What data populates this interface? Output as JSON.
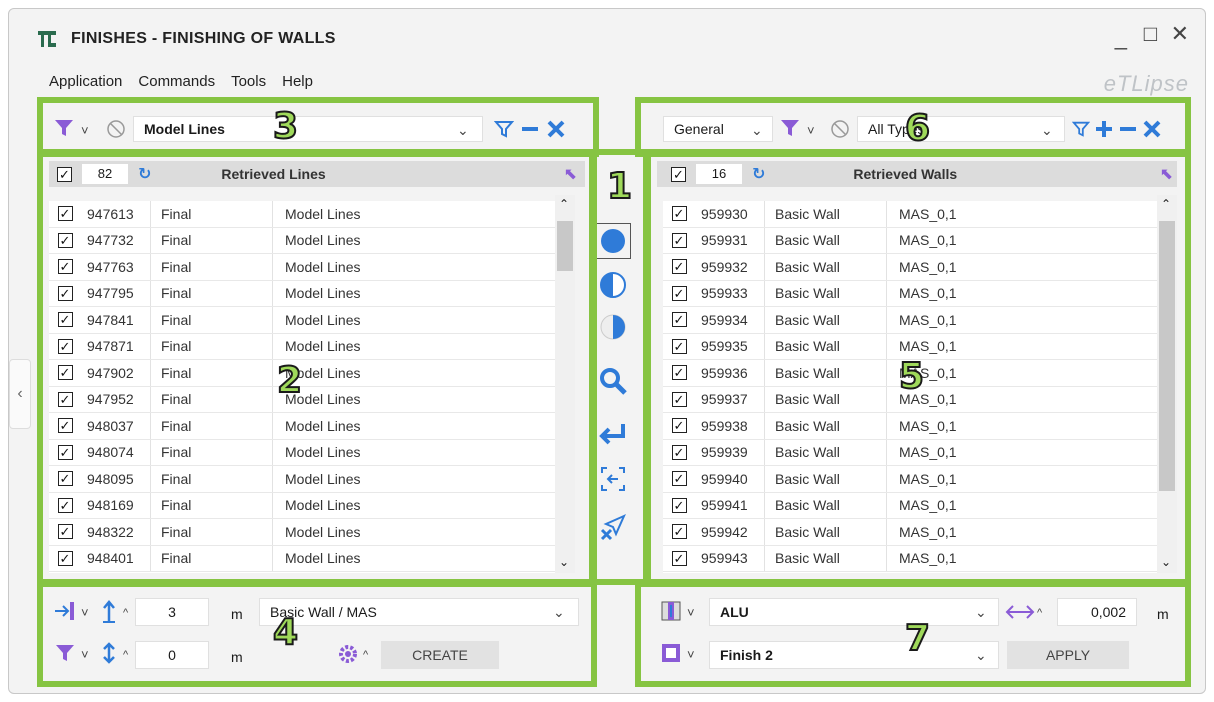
{
  "window": {
    "title": "FINISHES - FINISHING OF WALLS",
    "brand": "eTLipse"
  },
  "menu": [
    "Application",
    "Commands",
    "Tools",
    "Help"
  ],
  "left_filter": {
    "selected": "Model Lines"
  },
  "right_filter": {
    "category": "General",
    "selected": "All Types"
  },
  "left_list": {
    "count": "82",
    "header": "Retrieved Lines",
    "rows": [
      [
        "947613",
        "Final",
        "Model Lines"
      ],
      [
        "947732",
        "Final",
        "Model Lines"
      ],
      [
        "947763",
        "Final",
        "Model Lines"
      ],
      [
        "947795",
        "Final",
        "Model Lines"
      ],
      [
        "947841",
        "Final",
        "Model Lines"
      ],
      [
        "947871",
        "Final",
        "Model Lines"
      ],
      [
        "947902",
        "Final",
        "Model Lines"
      ],
      [
        "947952",
        "Final",
        "Model Lines"
      ],
      [
        "948037",
        "Final",
        "Model Lines"
      ],
      [
        "948074",
        "Final",
        "Model Lines"
      ],
      [
        "948095",
        "Final",
        "Model Lines"
      ],
      [
        "948169",
        "Final",
        "Model Lines"
      ],
      [
        "948322",
        "Final",
        "Model Lines"
      ],
      [
        "948401",
        "Final",
        "Model Lines"
      ]
    ]
  },
  "right_list": {
    "count": "16",
    "header": "Retrieved Walls",
    "rows": [
      [
        "959930",
        "Basic Wall",
        "MAS_0,1"
      ],
      [
        "959931",
        "Basic Wall",
        "MAS_0,1"
      ],
      [
        "959932",
        "Basic Wall",
        "MAS_0,1"
      ],
      [
        "959933",
        "Basic Wall",
        "MAS_0,1"
      ],
      [
        "959934",
        "Basic Wall",
        "MAS_0,1"
      ],
      [
        "959935",
        "Basic Wall",
        "MAS_0,1"
      ],
      [
        "959936",
        "Basic Wall",
        "MAS_0,1"
      ],
      [
        "959937",
        "Basic Wall",
        "MAS_0,1"
      ],
      [
        "959938",
        "Basic Wall",
        "MAS_0,1"
      ],
      [
        "959939",
        "Basic Wall",
        "MAS_0,1"
      ],
      [
        "959940",
        "Basic Wall",
        "MAS_0,1"
      ],
      [
        "959941",
        "Basic Wall",
        "MAS_0,1"
      ],
      [
        "959942",
        "Basic Wall",
        "MAS_0,1"
      ],
      [
        "959943",
        "Basic Wall",
        "MAS_0,1"
      ]
    ]
  },
  "create_panel": {
    "height_value": "3",
    "height_unit": "m",
    "offset_value": "0",
    "offset_unit": "m",
    "wall_type": "Basic Wall / MAS",
    "create_label": "CREATE"
  },
  "apply_panel": {
    "material": "ALU",
    "thickness_value": "0,002",
    "thickness_unit": "m",
    "finish": "Finish 2",
    "apply_label": "APPLY"
  },
  "annotations": [
    "1",
    "2",
    "3",
    "4",
    "5",
    "6",
    "7"
  ],
  "colors": {
    "accent_purple": "#8a5bd6",
    "accent_blue": "#2f7bd8",
    "annotation_green": "#86c442"
  }
}
